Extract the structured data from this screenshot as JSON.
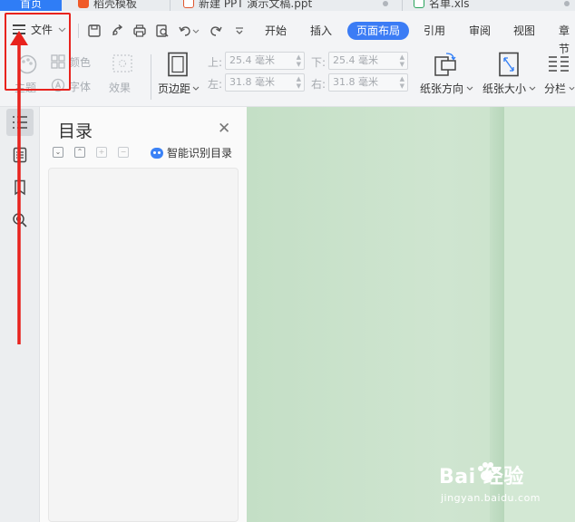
{
  "tabs": {
    "home": "首页",
    "template": "稻壳模板",
    "ppt": "新建 PPT 演示文稿.ppt",
    "xls": "名单.xls"
  },
  "menu": {
    "file": "文件",
    "tabs": [
      "开始",
      "插入",
      "页面布局",
      "引用",
      "审阅",
      "视图",
      "章节"
    ],
    "active_tab": "页面布局"
  },
  "ribbon": {
    "color": "颜色",
    "theme": "主题",
    "font": "字体",
    "effect": "效果",
    "margin": "页边距",
    "top_label": "上:",
    "bottom_label": "下:",
    "left_label": "左:",
    "right_label": "右:",
    "top_value": "25.4 毫米",
    "bottom_value": "25.4 毫米",
    "left_value": "31.8 毫米",
    "right_value": "31.8 毫米",
    "orientation": "纸张方向",
    "size": "纸张大小",
    "columns": "分栏"
  },
  "toc": {
    "title": "目录",
    "smart_label": "智能识别目录"
  },
  "watermark": {
    "logo": "Bai 经验",
    "url": "jingyan.baidu.com"
  },
  "colors": {
    "accent": "#3b7cf5",
    "annotation": "#e8221d",
    "document_bg": "#cfe5d0"
  }
}
